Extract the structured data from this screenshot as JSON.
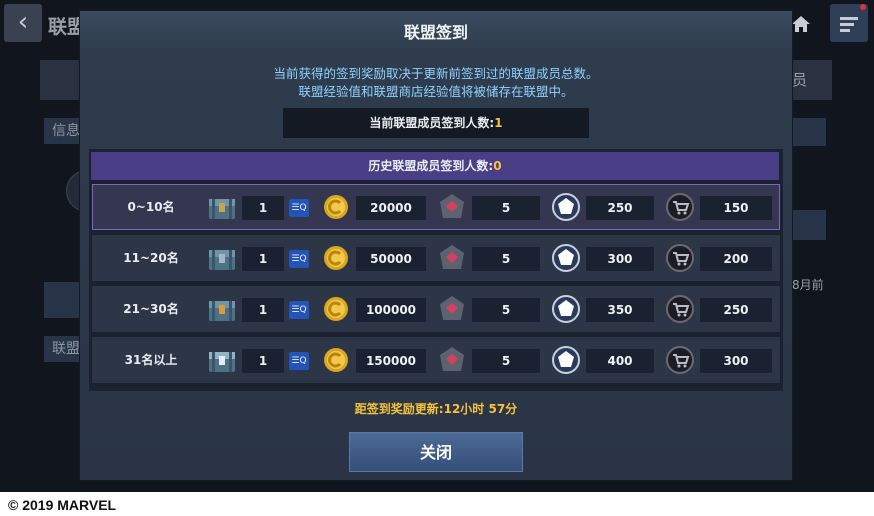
{
  "background": {
    "title": "联盟",
    "right_tab": "员",
    "tab_info": "信息",
    "tab_alliance": "联盟",
    "time_text": "8月前"
  },
  "modal": {
    "title": "联盟签到",
    "desc_line1": "当前获得的签到奖励取决于更新前签到过的联盟成员总数。",
    "desc_line2": "联盟经验值和联盟商店经验值将被储存在联盟中。",
    "current_label": "当前联盟成员签到人数:",
    "current_value": "1",
    "history_label": "历史联盟成员签到人数:",
    "history_value": "0",
    "rows": [
      {
        "rank": "0~10名",
        "chest": "1",
        "gold": "20000",
        "crystal": "5",
        "badge": "250",
        "cart": "150"
      },
      {
        "rank": "11~20名",
        "chest": "1",
        "gold": "50000",
        "crystal": "5",
        "badge": "300",
        "cart": "200"
      },
      {
        "rank": "21~30名",
        "chest": "1",
        "gold": "100000",
        "crystal": "5",
        "badge": "350",
        "cart": "250"
      },
      {
        "rank": "31名以上",
        "chest": "1",
        "gold": "150000",
        "crystal": "5",
        "badge": "400",
        "cart": "300"
      }
    ],
    "countdown": "距签到奖励更新:12小时 57分",
    "close_label": "关闭"
  },
  "footer": "© 2019 MARVEL",
  "colors": {
    "accent": "#f5c33a",
    "info_text": "#8fd3ff",
    "header_purple": "#4a3f86",
    "selected_border": "#7f63c8"
  }
}
